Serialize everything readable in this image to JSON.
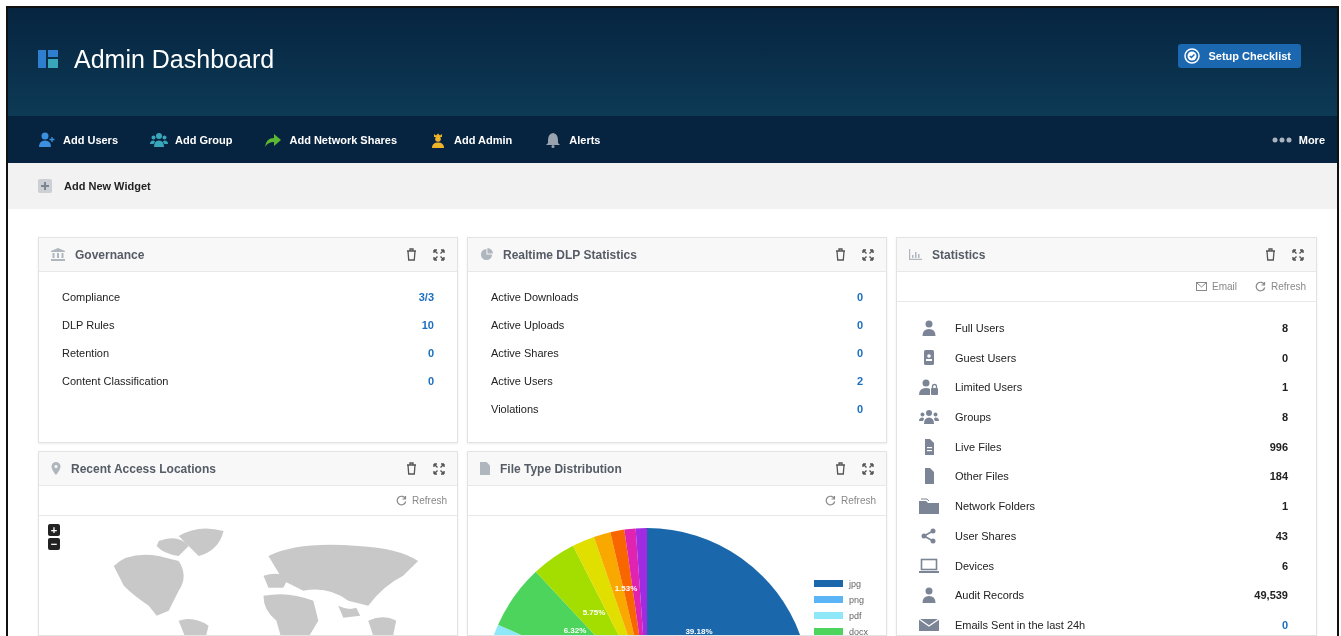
{
  "header": {
    "title": "Admin Dashboard",
    "setup_button": "Setup Checklist"
  },
  "nav": [
    {
      "label": "Add Users"
    },
    {
      "label": "Add Group"
    },
    {
      "label": "Add Network Shares"
    },
    {
      "label": "Add Admin"
    },
    {
      "label": "Alerts"
    }
  ],
  "more": "More",
  "add_widget": "Add New Widget",
  "governance": {
    "title": "Governance",
    "rows": [
      {
        "label": "Compliance",
        "value": "3/3"
      },
      {
        "label": "DLP Rules",
        "value": "10"
      },
      {
        "label": "Retention",
        "value": "0"
      },
      {
        "label": "Content Classification",
        "value": "0"
      }
    ]
  },
  "realtime": {
    "title": "Realtime DLP Statistics",
    "rows": [
      {
        "label": "Active Downloads",
        "value": "0"
      },
      {
        "label": "Active Uploads",
        "value": "0"
      },
      {
        "label": "Active Shares",
        "value": "0"
      },
      {
        "label": "Active Users",
        "value": "2"
      },
      {
        "label": "Violations",
        "value": "0"
      }
    ]
  },
  "locations": {
    "title": "Recent Access Locations",
    "refresh": "Refresh",
    "zoom_in": "+",
    "zoom_out": "−"
  },
  "file_types": {
    "title": "File Type Distribution",
    "refresh": "Refresh",
    "slice_labels": [
      "39.18%",
      "6.32%",
      "5.75%",
      "1.53%"
    ],
    "legend": [
      {
        "label": "jpg",
        "color": "#1a68ab"
      },
      {
        "label": "png",
        "color": "#5ab4f5"
      },
      {
        "label": "pdf",
        "color": "#8ee8f8"
      },
      {
        "label": "docx",
        "color": "#4cd45c"
      }
    ]
  },
  "statistics": {
    "title": "Statistics",
    "email": "Email",
    "refresh": "Refresh",
    "rows": [
      {
        "label": "Full Users",
        "value": "8",
        "link": false
      },
      {
        "label": "Guest Users",
        "value": "0",
        "link": false
      },
      {
        "label": "Limited Users",
        "value": "1",
        "link": false
      },
      {
        "label": "Groups",
        "value": "8",
        "link": false
      },
      {
        "label": "Live Files",
        "value": "996",
        "link": false
      },
      {
        "label": "Other Files",
        "value": "184",
        "link": false
      },
      {
        "label": "Network Folders",
        "value": "1",
        "link": false
      },
      {
        "label": "User Shares",
        "value": "43",
        "link": false
      },
      {
        "label": "Devices",
        "value": "6",
        "link": false
      },
      {
        "label": "Audit Records",
        "value": "49,539",
        "link": false
      },
      {
        "label": "Emails Sent in the last 24h",
        "value": "0",
        "link": true
      }
    ]
  }
}
